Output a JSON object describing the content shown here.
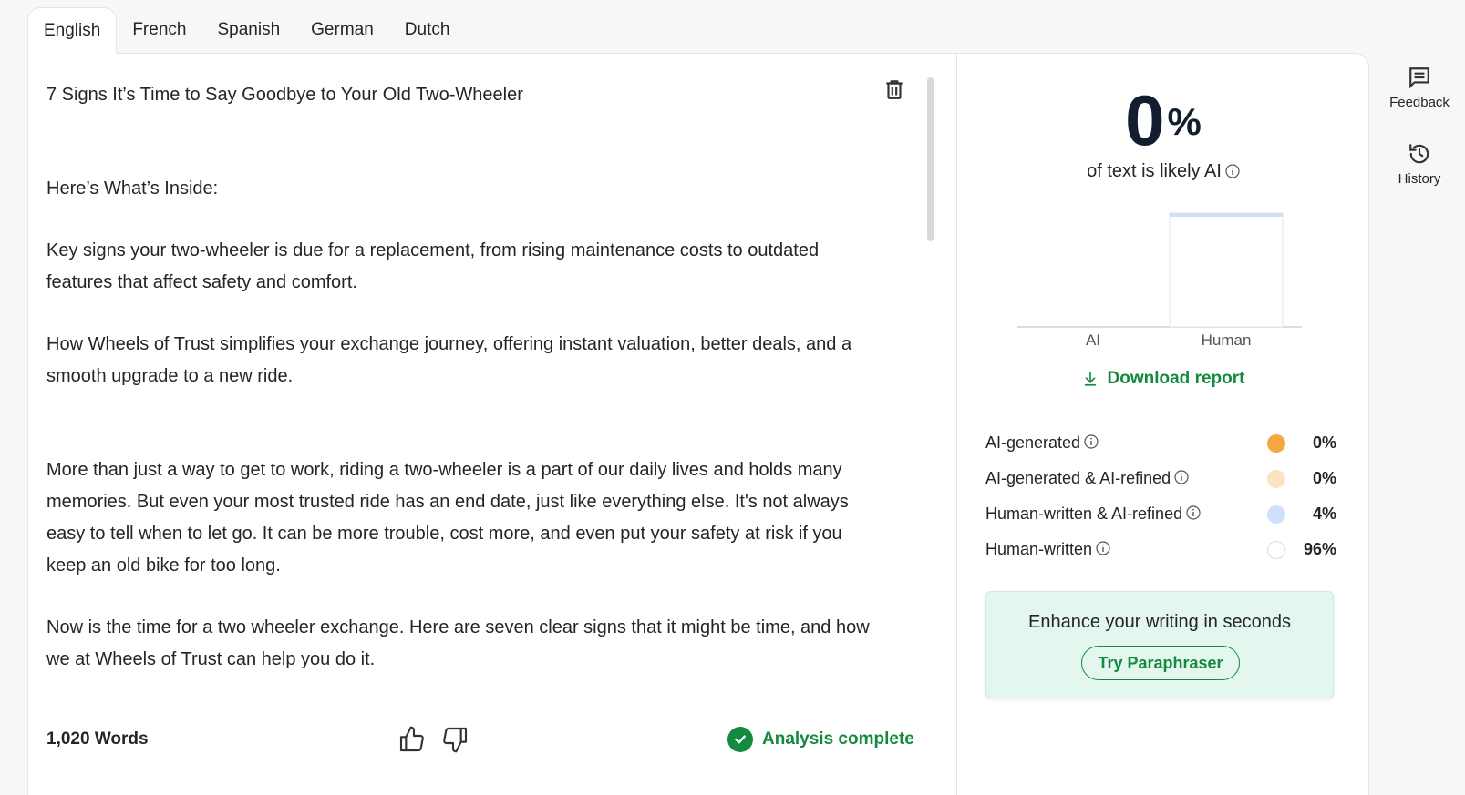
{
  "tabs": [
    {
      "label": "English",
      "active": true
    },
    {
      "label": "French",
      "active": false
    },
    {
      "label": "Spanish",
      "active": false
    },
    {
      "label": "German",
      "active": false
    },
    {
      "label": "Dutch",
      "active": false
    }
  ],
  "editor": {
    "paragraphs": [
      "7 Signs It’s Time to Say Goodbye to Your Old Two-Wheeler",
      "",
      "Here’s What’s Inside:",
      "Key signs your two-wheeler is due for a replacement, from rising maintenance costs to outdated features that affect safety and comfort.",
      "How Wheels of Trust simplifies your exchange journey, offering instant valuation, better deals, and a smooth upgrade to a new ride.",
      "",
      "More than just a way to get to work, riding a two-wheeler is a part of our daily lives and holds many memories. But even your most trusted ride has an end date, just like everything else. It's not always easy to tell when to let go. It can be more trouble, cost more, and even put your safety at risk if you keep an old bike for too long.",
      "Now is the time for a two wheeler exchange. Here are seven clear signs that it might be time, and how we at Wheels of Trust can help you do it."
    ],
    "word_count": "1,020 Words",
    "status": "Analysis complete",
    "icons": {
      "delete": "trash-icon",
      "like": "thumbs-up-icon",
      "dislike": "thumbs-down-icon",
      "status": "check-circle-icon"
    }
  },
  "results": {
    "percent_number": "0",
    "percent_sign": "%",
    "likely_label": "of text is likely AI",
    "download_label": "Download report",
    "chart_data": {
      "type": "bar",
      "categories": [
        "AI",
        "Human"
      ],
      "values": [
        0,
        100
      ],
      "ylim": [
        0,
        100
      ]
    },
    "legend": [
      {
        "label": "AI-generated",
        "value": "0%",
        "color": "#f5a742"
      },
      {
        "label": "AI-generated & AI-refined",
        "value": "0%",
        "color": "#fbe2c2"
      },
      {
        "label": "Human-written & AI-refined",
        "value": "4%",
        "color": "#cfe0fb"
      },
      {
        "label": "Human-written",
        "value": "96%",
        "color": "#ffffff"
      }
    ],
    "promo_title": "Enhance your writing in seconds",
    "promo_button": "Try Paraphraser"
  },
  "rail": {
    "feedback_label": "Feedback",
    "history_label": "History"
  },
  "colors": {
    "accent_green": "#148a3e",
    "dark_text": "#121e30",
    "human_bar_top": "#cfe0fb"
  }
}
